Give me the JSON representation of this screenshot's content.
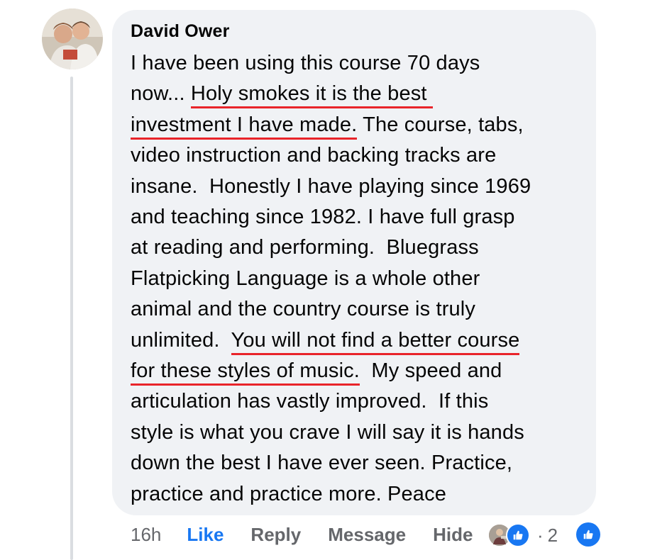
{
  "comment": {
    "author": "David Ower",
    "lines": [
      [
        {
          "t": "I have been using this course 70 days"
        }
      ],
      [
        {
          "t": "now... "
        },
        {
          "t": "Holy smokes it is the best ",
          "hl": true
        }
      ],
      [
        {
          "t": "investment I have made.",
          "hl": true
        },
        {
          "t": " The course, tabs,"
        }
      ],
      [
        {
          "t": "video instruction and backing tracks are"
        }
      ],
      [
        {
          "t": "insane.  Honestly I have playing since 1969"
        }
      ],
      [
        {
          "t": "and teaching since 1982. I have full grasp"
        }
      ],
      [
        {
          "t": "at reading and performing.  Bluegrass"
        }
      ],
      [
        {
          "t": "Flatpicking Language is a whole other"
        }
      ],
      [
        {
          "t": "animal and the country course is truly"
        }
      ],
      [
        {
          "t": "unlimited.  "
        },
        {
          "t": "You will not find a better course",
          "hl": true
        }
      ],
      [
        {
          "t": "for these styles of music.",
          "hl": true
        },
        {
          "t": "  My speed and"
        }
      ],
      [
        {
          "t": "articulation has vastly improved.  If this"
        }
      ],
      [
        {
          "t": "style is what you crave I will say it is hands"
        }
      ],
      [
        {
          "t": "down the best I have ever seen. Practice,"
        }
      ],
      [
        {
          "t": "practice and practice more. Peace"
        }
      ]
    ]
  },
  "actions": {
    "time": "16h",
    "like": "Like",
    "reply": "Reply",
    "message": "Message",
    "hide": "Hide",
    "dot": "·",
    "reaction_count": "2"
  },
  "icons": {
    "avatar": "profile-photo",
    "reaction_1": "user-photo-reaction-icon",
    "reaction_2": "like-reaction-icon",
    "reaction_3": "like-icon"
  },
  "colors": {
    "bubble": "#f0f2f5",
    "text": "#050505",
    "muted": "#65676b",
    "like_blue": "#1877f2",
    "highlight_underline": "#e9242a"
  }
}
